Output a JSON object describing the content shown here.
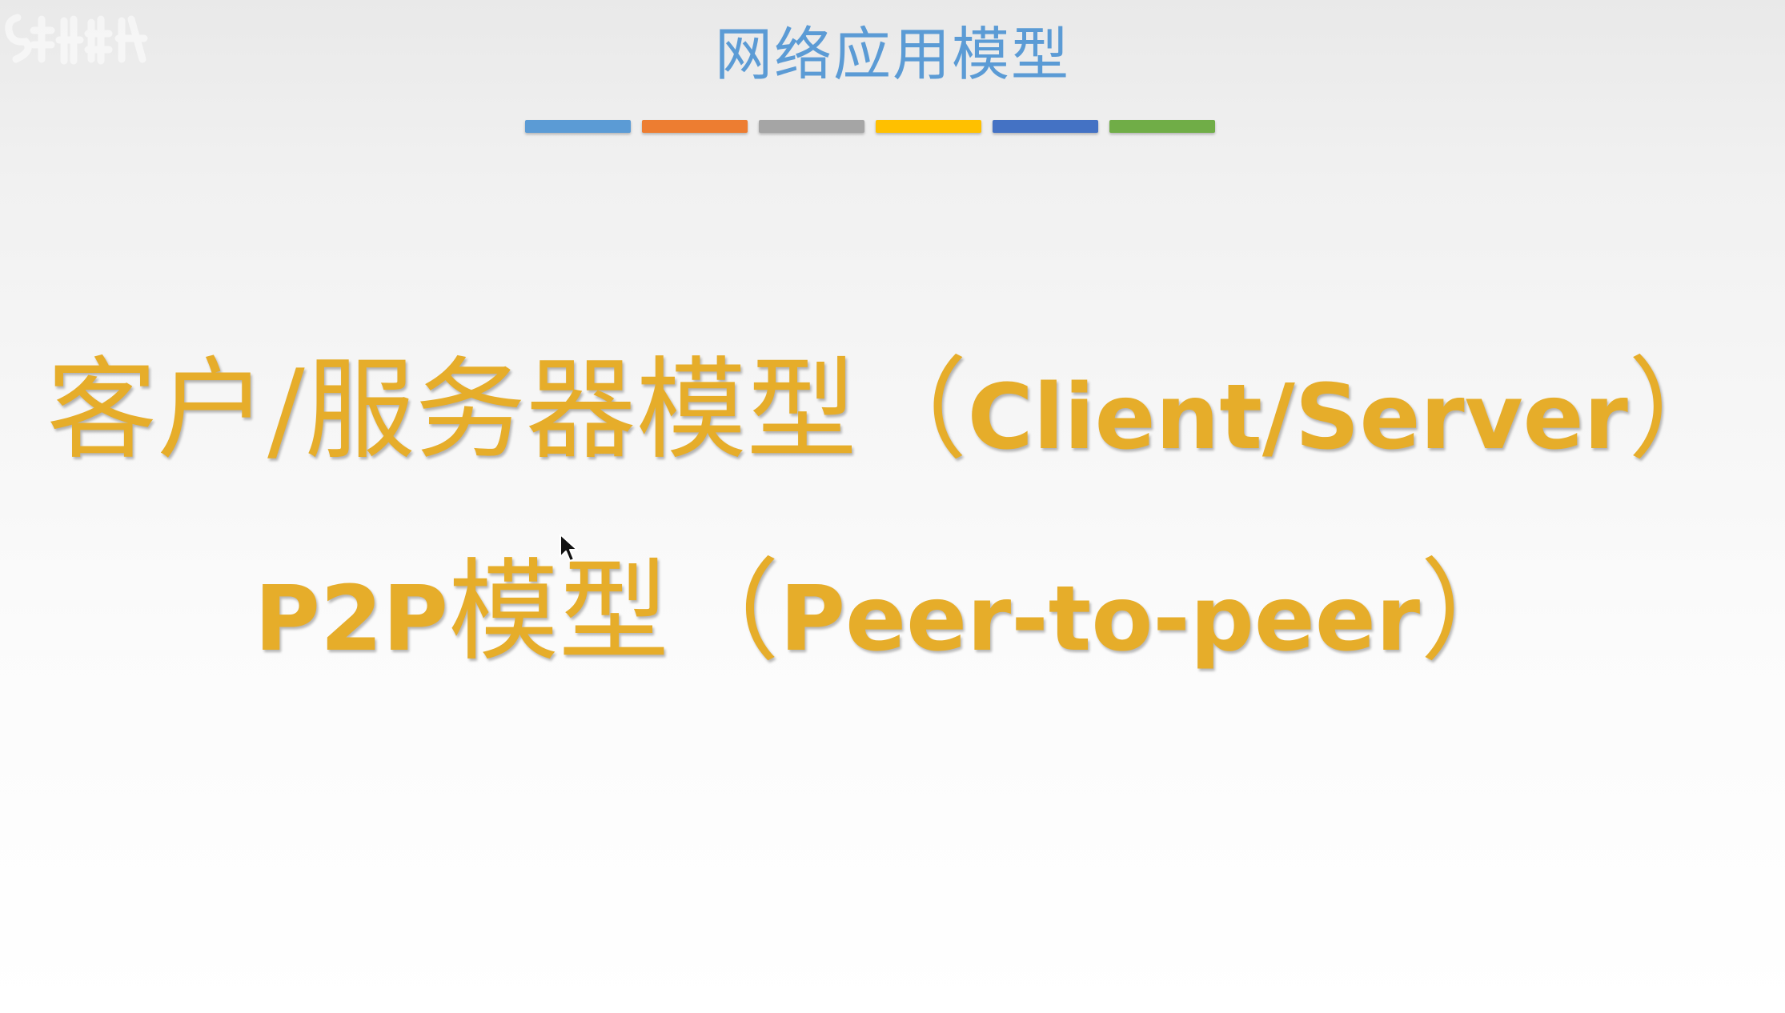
{
  "slide": {
    "title": "网络应用模型",
    "accent_bars": [
      "#5b9bd5",
      "#ed7d31",
      "#a5a5a5",
      "#ffc000",
      "#4472c4",
      "#70ad47"
    ],
    "text_color": "#e6ad2a",
    "title_color": "#5b9bd5",
    "models": [
      {
        "cn": "客户/服务器模型",
        "open": "（",
        "en": "Client/Server",
        "close": "）"
      },
      {
        "prefix": "P2P",
        "cn": "模型",
        "open": "（",
        "en": "Peer-to-peer",
        "close": "）"
      }
    ]
  },
  "icons": {
    "cursor": "mouse-pointer-icon",
    "watermark": "watermark-logo-icon"
  }
}
